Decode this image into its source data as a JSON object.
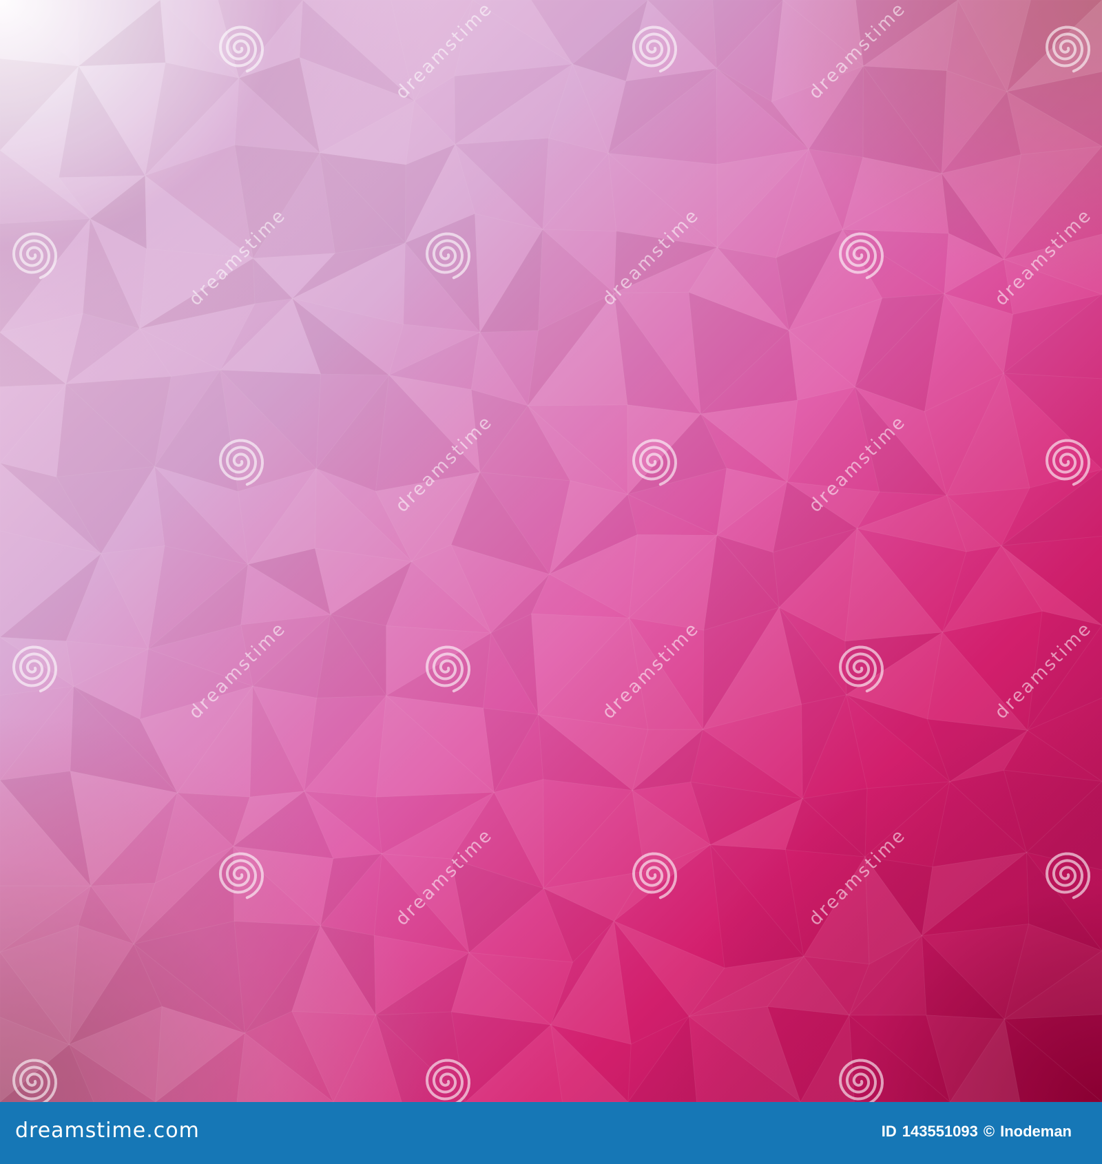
{
  "image": {
    "description_type": "low-poly gradient background",
    "colors": {
      "top_left": "#f4ecf4",
      "center": "#df60ad",
      "bottom_right": "#8e0040",
      "top_right": "#b7707f",
      "bottom_left": "#b87a90"
    }
  },
  "watermark": {
    "text": "dreamstime",
    "icon": "spiral-icon"
  },
  "footer": {
    "logo_text": "dreamstime.com",
    "id_label": "ID",
    "id_value": "143551093",
    "copyright_symbol": "©",
    "author": "Inodeman",
    "background_color": "#1677b6"
  }
}
